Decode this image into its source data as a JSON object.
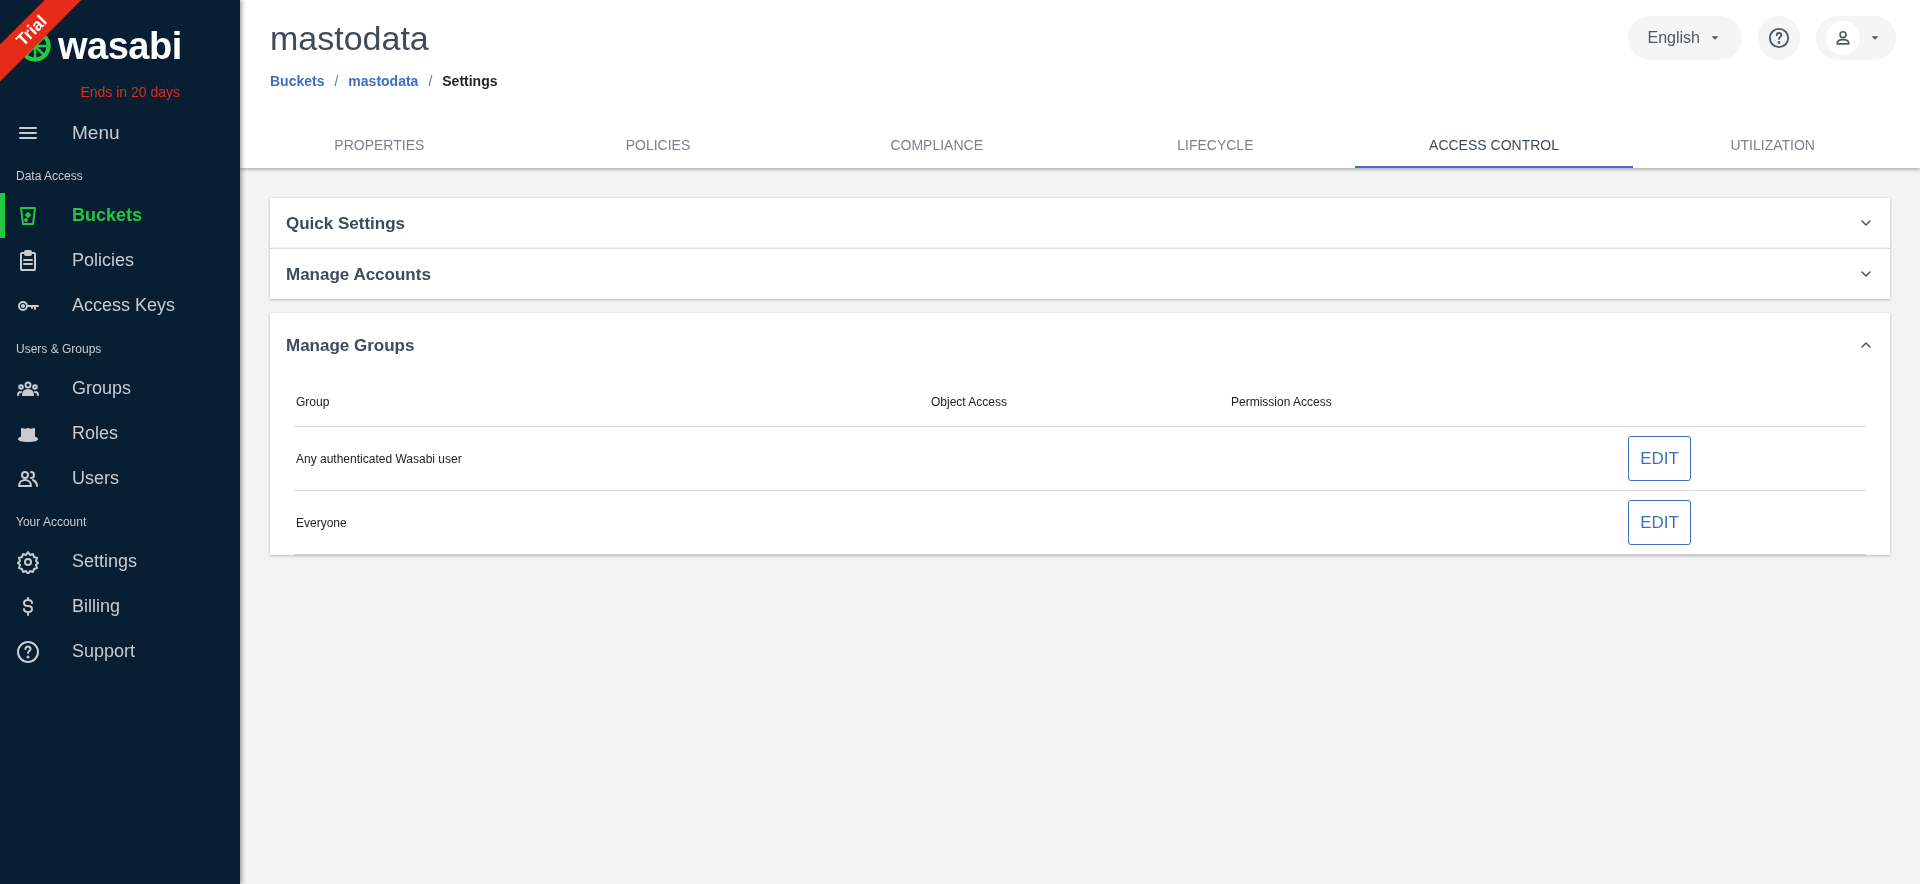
{
  "brand": {
    "ribbon": "Trial",
    "logo": "wasabi",
    "trial_note": "Ends in 20 days"
  },
  "sidebar": {
    "menu": "Menu",
    "sections": [
      {
        "title": "Data Access",
        "items": [
          {
            "label": "Buckets",
            "selected": true
          },
          {
            "label": "Policies",
            "selected": false
          },
          {
            "label": "Access Keys",
            "selected": false
          }
        ]
      },
      {
        "title": "Users & Groups",
        "items": [
          {
            "label": "Groups",
            "selected": false
          },
          {
            "label": "Roles",
            "selected": false
          },
          {
            "label": "Users",
            "selected": false
          }
        ]
      },
      {
        "title": "Your Account",
        "items": [
          {
            "label": "Settings",
            "selected": false
          },
          {
            "label": "Billing",
            "selected": false
          },
          {
            "label": "Support",
            "selected": false
          }
        ]
      }
    ]
  },
  "header": {
    "title": "mastodata",
    "breadcrumb": [
      {
        "kind": "link",
        "label": "Buckets"
      },
      {
        "kind": "separator",
        "label": "/"
      },
      {
        "kind": "link",
        "label": "mastodata"
      },
      {
        "kind": "separator",
        "label": "/"
      },
      {
        "kind": "current",
        "label": "Settings"
      }
    ],
    "language": "English"
  },
  "tabs": [
    {
      "label": "PROPERTIES",
      "selected": false
    },
    {
      "label": "POLICIES",
      "selected": false
    },
    {
      "label": "COMPLIANCE",
      "selected": false
    },
    {
      "label": "LIFECYCLE",
      "selected": false
    },
    {
      "label": "ACCESS CONTROL",
      "selected": true
    },
    {
      "label": "UTILIZATION",
      "selected": false
    }
  ],
  "panels": [
    {
      "title": "Quick Settings",
      "expanded": false
    },
    {
      "title": "Manage Accounts",
      "expanded": false
    },
    {
      "title": "Manage Groups",
      "expanded": true,
      "table": {
        "columns": [
          "Group",
          "Object Access",
          "Permission Access"
        ],
        "rows": [
          {
            "group": "Any authenticated Wasabi user",
            "action": "EDIT"
          },
          {
            "group": "Everyone",
            "action": "EDIT"
          }
        ]
      }
    }
  ]
}
